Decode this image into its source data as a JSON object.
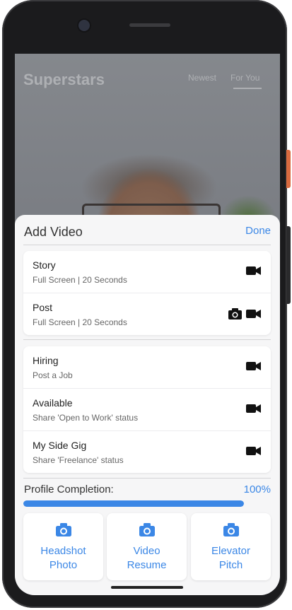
{
  "background_app": {
    "title": "Superstars",
    "tabs": [
      {
        "label": "Newest"
      },
      {
        "label": "For You",
        "active": true
      }
    ]
  },
  "sheet": {
    "title": "Add Video",
    "done_label": "Done",
    "groups": [
      {
        "items": [
          {
            "title": "Story",
            "subtitle": "Full Screen | 20 Seconds",
            "icons": [
              "video-camera-icon"
            ]
          },
          {
            "title": "Post",
            "subtitle": "Full Screen | 20 Seconds",
            "icons": [
              "photo-camera-icon",
              "video-camera-icon"
            ]
          }
        ]
      },
      {
        "items": [
          {
            "title": "Hiring",
            "subtitle": "Post a Job",
            "icons": [
              "video-camera-icon"
            ]
          },
          {
            "title": "Available",
            "subtitle": "Share 'Open to Work' status",
            "icons": [
              "video-camera-icon"
            ]
          },
          {
            "title": "My Side Gig",
            "subtitle": "Share 'Freelance' status",
            "icons": [
              "video-camera-icon"
            ]
          }
        ]
      }
    ],
    "profile": {
      "label": "Profile Completion:",
      "value_text": "100%",
      "progress_fraction": 1.0
    },
    "tiles": [
      {
        "label": "Headshot\nPhoto",
        "icon": "photo-camera-icon"
      },
      {
        "label": "Video\nResume",
        "icon": "photo-camera-icon"
      },
      {
        "label": "Elevator\nPitch",
        "icon": "photo-camera-icon"
      }
    ]
  },
  "colors": {
    "accent": "#3b87e6",
    "sheet_background": "#f6f6f7",
    "text_primary": "#1f1f1f",
    "text_secondary": "#666666"
  }
}
